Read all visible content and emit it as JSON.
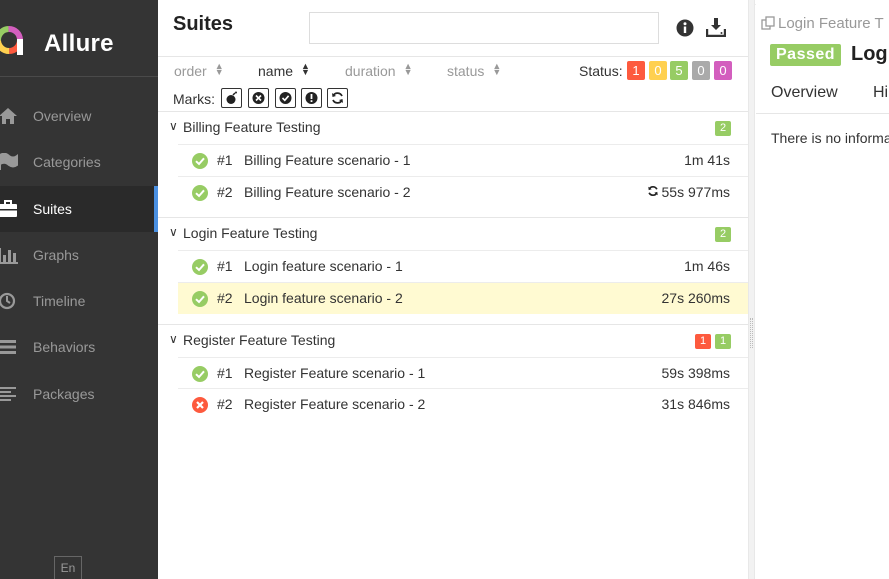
{
  "brand": {
    "name": "Allure"
  },
  "sidebar": {
    "items": [
      {
        "label": "Overview",
        "icon": "home-icon",
        "active": false
      },
      {
        "label": "Categories",
        "icon": "flag-icon",
        "active": false
      },
      {
        "label": "Suites",
        "icon": "briefcase-icon",
        "active": true
      },
      {
        "label": "Graphs",
        "icon": "bar-chart-icon",
        "active": false
      },
      {
        "label": "Timeline",
        "icon": "clock-icon",
        "active": false
      },
      {
        "label": "Behaviors",
        "icon": "list-icon",
        "active": false
      },
      {
        "label": "Packages",
        "icon": "align-left-icon",
        "active": false
      }
    ],
    "language": "En"
  },
  "suites": {
    "title": "Suites",
    "search": {
      "value": "",
      "placeholder": ""
    },
    "sort": {
      "order": "order",
      "name": "name",
      "duration": "duration",
      "status": "status"
    },
    "status_filter": {
      "label": "Status:",
      "counts": [
        {
          "value": "1",
          "status": "failed",
          "color": "#fd5a3e"
        },
        {
          "value": "0",
          "status": "broken",
          "color": "#ffd050"
        },
        {
          "value": "5",
          "status": "passed",
          "color": "#97cc64"
        },
        {
          "value": "0",
          "status": "skipped",
          "color": "#aaaaaa"
        },
        {
          "value": "0",
          "status": "unknown",
          "color": "#d35ebe"
        }
      ]
    },
    "marks": {
      "label": "Marks:"
    },
    "groups": [
      {
        "name": "Billing Feature Testing",
        "counts": [
          {
            "value": "2",
            "color": "#97cc64"
          }
        ],
        "tests": [
          {
            "num": "#1",
            "name": "Billing Feature scenario - 1",
            "duration": "1m 41s",
            "status": "passed",
            "retry": false
          },
          {
            "num": "#2",
            "name": "Billing Feature scenario - 2",
            "duration": "55s 977ms",
            "status": "passed",
            "retry": true
          }
        ]
      },
      {
        "name": "Login Feature Testing",
        "counts": [
          {
            "value": "2",
            "color": "#97cc64"
          }
        ],
        "tests": [
          {
            "num": "#1",
            "name": "Login feature scenario - 1",
            "duration": "1m 46s",
            "status": "passed",
            "retry": false
          },
          {
            "num": "#2",
            "name": "Login feature scenario - 2",
            "duration": "27s 260ms",
            "status": "passed",
            "retry": false,
            "selected": true
          }
        ]
      },
      {
        "name": "Register Feature Testing",
        "counts": [
          {
            "value": "1",
            "color": "#fd5a3e"
          },
          {
            "value": "1",
            "color": "#97cc64"
          }
        ],
        "tests": [
          {
            "num": "#1",
            "name": "Register Feature scenario - 1",
            "duration": "59s 398ms",
            "status": "passed",
            "retry": false
          },
          {
            "num": "#2",
            "name": "Register Feature scenario - 2",
            "duration": "31s 846ms",
            "status": "failed",
            "retry": false
          }
        ]
      }
    ]
  },
  "detail": {
    "breadcrumb": "Login Feature T",
    "status": "Passed",
    "title": "Logi",
    "tabs": [
      "Overview",
      "Hi"
    ],
    "message": "There is no informa"
  },
  "colors": {
    "passed": "#97cc64",
    "failed": "#fd5a3e",
    "sidebar_bg": "#343434",
    "accent": "#4a90e2",
    "selected_row": "#fffad2"
  }
}
